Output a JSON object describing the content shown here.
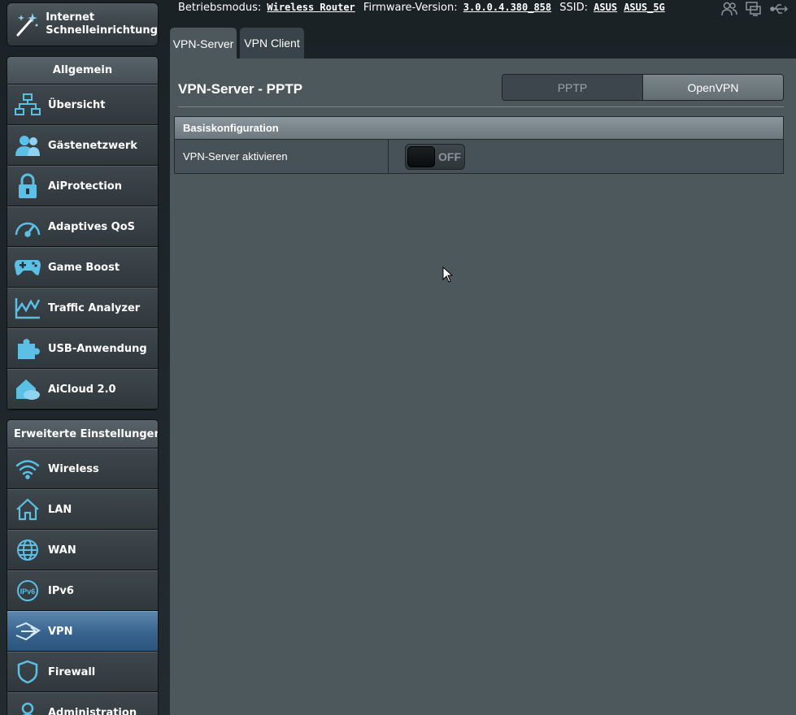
{
  "header": {
    "mode_label": "Betriebsmodus:",
    "mode_value": "Wireless Router",
    "fw_label": "Firmware-Version:",
    "fw_value": "3.0.0.4.380_858",
    "ssid_label": "SSID:",
    "ssid_1": "ASUS",
    "ssid_2": "ASUS_5G",
    "icons": [
      "users-icon",
      "devices-icon",
      "usb-icon"
    ]
  },
  "sidebar": {
    "quick_setup": {
      "line1": "Internet",
      "line2": "Schnelleinrichtung",
      "icon": "magic-wand-icon"
    },
    "general": {
      "title": "Allgemein",
      "items": [
        {
          "label": "Übersicht",
          "icon": "network-map-icon"
        },
        {
          "label": "Gästenetzwerk",
          "icon": "guests-icon"
        },
        {
          "label": "AiProtection",
          "icon": "lock-icon"
        },
        {
          "label": "Adaptives QoS",
          "icon": "gauge-icon"
        },
        {
          "label": "Game Boost",
          "icon": "gamepad-icon"
        },
        {
          "label": "Traffic Analyzer",
          "icon": "chart-icon"
        },
        {
          "label": "USB-Anwendung",
          "icon": "puzzle-icon"
        },
        {
          "label": "AiCloud 2.0",
          "icon": "cloud-home-icon"
        }
      ]
    },
    "advanced": {
      "title": "Erweiterte Einstellungen",
      "items": [
        {
          "label": "Wireless",
          "icon": "wifi-icon"
        },
        {
          "label": "LAN",
          "icon": "home-icon"
        },
        {
          "label": "WAN",
          "icon": "globe-icon"
        },
        {
          "label": "IPv6",
          "icon": "ipv6-icon"
        },
        {
          "label": "VPN",
          "icon": "vpn-icon",
          "active": true
        },
        {
          "label": "Firewall",
          "icon": "shield-icon"
        },
        {
          "label": "Administration",
          "icon": "admin-icon"
        }
      ]
    }
  },
  "tabs": [
    {
      "label": "VPN-Server",
      "active": true
    },
    {
      "label": "VPN Client",
      "active": false
    }
  ],
  "main": {
    "title": "VPN-Server - PPTP",
    "segments": [
      {
        "label": "PPTP",
        "selected": true
      },
      {
        "label": "OpenVPN",
        "selected": false
      }
    ],
    "section_title": "Basiskonfiguration",
    "rows": [
      {
        "label": "VPN-Server aktivieren",
        "toggle_state": "OFF"
      }
    ]
  },
  "colors": {
    "accent": "#37638d",
    "icon": "#5bbfe6"
  }
}
